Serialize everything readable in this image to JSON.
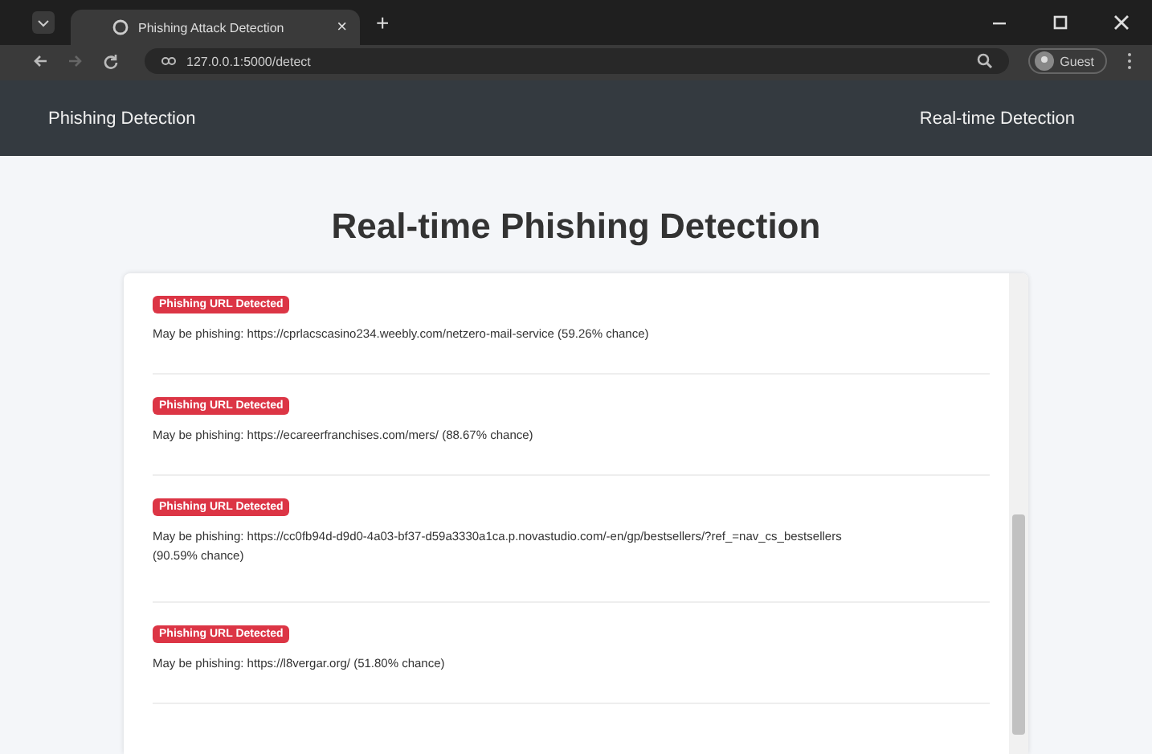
{
  "browser": {
    "tab_title": "Phishing Attack Detection",
    "tab_close": "×",
    "new_tab": "+",
    "url": "127.0.0.1:5000/detect",
    "profile": "Guest"
  },
  "navbar": {
    "brand": "Phishing Detection",
    "link": "Real-time Detection"
  },
  "page": {
    "heading": "Real-time Phishing Detection"
  },
  "results": [
    {
      "badge": "Phishing URL Detected",
      "message": "May be phishing: https://cprlacscasino234.weebly.com/netzero-mail-service (59.26% chance)"
    },
    {
      "badge": "Phishing URL Detected",
      "message": "May be phishing: https://ecareerfranchises.com/mers/ (88.67% chance)"
    },
    {
      "badge": "Phishing URL Detected",
      "message": "May be phishing: https://cc0fb94d-d9d0-4a03-bf37-d59a3330a1ca.p.novastudio.com/-en/gp/bestsellers/?ref_=nav_cs_bestsellers (90.59% chance)"
    },
    {
      "badge": "Phishing URL Detected",
      "message": "May be phishing: https://l8vergar.org/ (51.80% chance)"
    }
  ]
}
